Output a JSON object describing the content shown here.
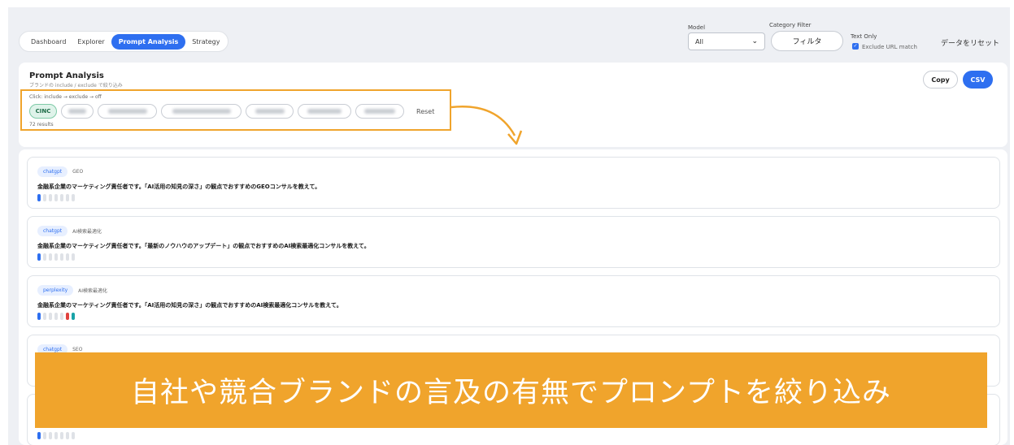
{
  "nav": {
    "tabs": [
      {
        "label": "Dashboard"
      },
      {
        "label": "Explorer"
      },
      {
        "label": "Prompt Analysis"
      },
      {
        "label": "Strategy"
      }
    ]
  },
  "controls": {
    "model_label": "Model",
    "model_value": "All",
    "category_label": "Category Filter",
    "filter_button": "フィルタ",
    "text_only_label": "Text Only",
    "exclude_url_label": "Exclude URL match",
    "exclude_url_checked": true,
    "reset_data": "データをリセット"
  },
  "analysis": {
    "title": "Prompt Analysis",
    "subtitle": "ブランドの include / exclude で絞り込み",
    "click_hint": "Click: include → exclude → off",
    "chips": [
      {
        "label": "CINC",
        "active": true
      }
    ],
    "reset_label": "Reset",
    "results_text": "72 results",
    "copy_label": "Copy",
    "csv_label": "CSV"
  },
  "results": [
    {
      "model": "chatgpt",
      "category": "GEO",
      "prompt": "金融系企業のマーケティング責任者です。「AI活用の知見の深さ」の観点でおすすめのGEOコンサルを教えて。"
    },
    {
      "model": "chatgpt",
      "category": "AI検索最適化",
      "prompt": "金融系企業のマーケティング責任者です。「最新のノウハウのアップデート」の観点でおすすめのAI検索最適化コンサルを教えて。"
    },
    {
      "model": "perplexity",
      "category": "AI検索最適化",
      "prompt": "金融系企業のマーケティング責任者です。「AI活用の知見の深さ」の観点でおすすめのAI検索最適化コンサルを教えて。"
    },
    {
      "model": "chatgpt",
      "category": "SEO",
      "prompt": ""
    }
  ],
  "bar_colors": {
    "active": "#2e6ff0",
    "inactive": "#dfe2e7",
    "red": "#e0413e",
    "teal": "#19a3a8"
  },
  "banner": {
    "text": "自社や競合ブランドの言及の有無でプロンプトを絞り込み"
  },
  "colors": {
    "accent": "#2e6ff0",
    "highlight": "#f0a42c",
    "chip_active": "#dff3ea"
  }
}
